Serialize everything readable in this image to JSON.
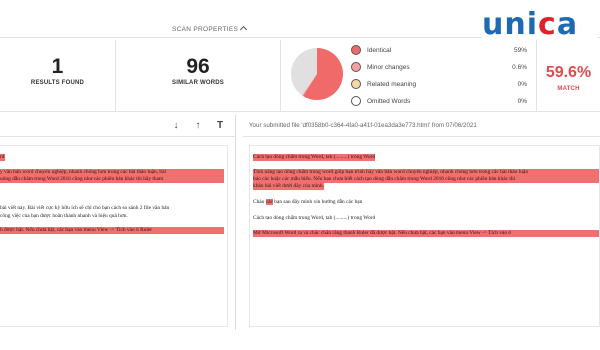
{
  "scan": {
    "label": "SCAN PROPERTIES"
  },
  "logo": {
    "text_u": "u",
    "text_n": "n",
    "text_i": "i",
    "text_c": "c",
    "text_a": "a"
  },
  "stats": {
    "results_found": {
      "value": "1",
      "caption": "RESULTS FOUND"
    },
    "similar_words": {
      "value": "96",
      "caption": "SIMILAR WORDS"
    },
    "match": {
      "value": "59.6%",
      "caption": "MATCH"
    }
  },
  "legend": [
    {
      "name": "Identical",
      "pct": "59%",
      "color": "#f06a6a",
      "fraction": 0.59
    },
    {
      "name": "Minor changes",
      "pct": "0.6%",
      "color": "#f5a0a0",
      "fraction": 0.006
    },
    {
      "name": "Related meaning",
      "pct": "0%",
      "color": "#f7d9a8",
      "fraction": 0
    },
    {
      "name": "Omitted Words",
      "pct": "0%",
      "color": "#ffffff",
      "fraction": 0
    }
  ],
  "toolbar_right": {
    "text": "Your submitted file 'df0358b0-c364-4fa0-a41f-01ea3da3e773.html' from 07/06/2021"
  },
  "doc_left": {
    "l1": "rd",
    "l2": "y văn bản word chuyên nghiệp, nhanh chóng hơn trong các bài thảo luận, bài",
    "l3": "uông dẫn chăm trong Word 2016 cũng như các phiên bản khác thì hãy tham",
    "l4": "bài viết này. Bài viết cực kỳ hữu ích sẽ chỉ cho bạn cách so sánh 2 file văn bản",
    "l5": "công việc của bạn được hoàn thành nhanh và hiệu quả hơn.",
    "l6": "h được bật. Nếu chưa bật, các bạn vào menu View -> Tích vào ô Ruler"
  },
  "doc_right": {
    "r1": "Cách tạo dòng chấm trong Word, tab (.........) trong Word",
    "r2": "Tính năng tạo dòng chấm trong word giúp bạn trình bày văn bản word chuyên nghiệp, nhanh chóng hơn trong các bài thảo luận",
    "r3": "báo các hoặc các mẫu biểu. Nếu bạn chưa biết cách tạo dòng dẫn chăm trong Word 2016 cũng như các phiên bản khác thì",
    "r4": "khảo bài viết dưới đây của mình.",
    "r5a": "Chào ",
    "r5b": "các",
    "r5c": " bạn sau đây mình xin hướng dẫn các bạn",
    "r6": "Cách tạo dòng chấm trong Word, tab (.........) trong Word",
    "r7": "Mở Microsoft Word ra và chắc chắn rằng thanh Ruler đã được bật. Nếu chưa bật, các bạn vào menu View -> Tích vào ô"
  }
}
